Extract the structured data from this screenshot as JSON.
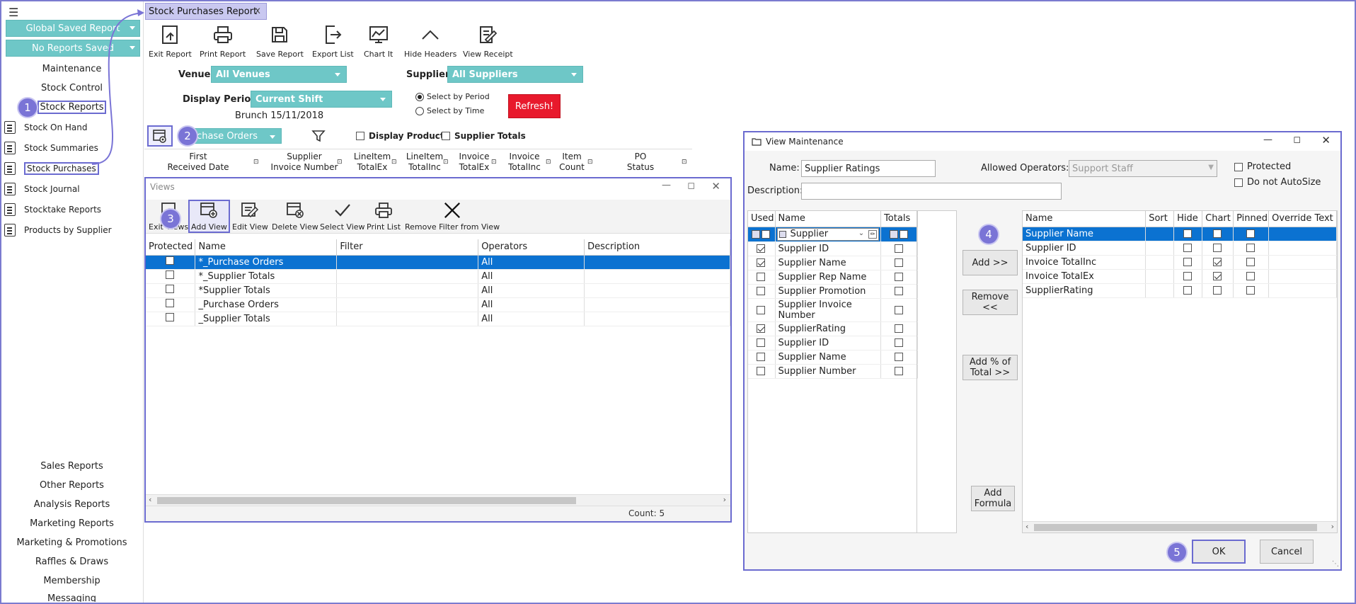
{
  "sidebar": {
    "global_saved": "Global Saved Report",
    "no_reports": "No Reports Saved",
    "links_top": [
      "Maintenance",
      "Stock Control",
      "Stock Reports"
    ],
    "sub_items": [
      "Stock On Hand",
      "Stock Summaries",
      "Stock Purchases",
      "Stock Journal",
      "Stocktake Reports",
      "Products by Supplier"
    ],
    "links_bottom": [
      "Sales Reports",
      "Other Reports",
      "Analysis Reports",
      "Marketing Reports",
      "Marketing & Promotions",
      "Raffles & Draws",
      "Membership",
      "Messaging"
    ]
  },
  "tab": {
    "title": "Stock Purchases Report",
    "close": "x"
  },
  "toolbar": [
    "Exit Report",
    "Print Report",
    "Save Report",
    "Export List",
    "Chart It",
    "Hide Headers",
    "View Receipt"
  ],
  "filters": {
    "venue_label": "Venue:",
    "venue_value": "All Venues",
    "supplier_label": "Supplier:",
    "supplier_value": "All Suppliers",
    "period_label": "Display Period:",
    "period_value": "Current Shift",
    "brunch": "Brunch 15/11/2018",
    "select_period": "Select by Period",
    "select_time": "Select  by Time",
    "refresh": "Refresh!",
    "view_dd": "rchase Orders",
    "display_products": "Display Products",
    "supplier_totals": "Supplier Totals"
  },
  "report_columns": [
    [
      "First",
      "Received Date"
    ],
    [
      "Supplier",
      "Invoice Number"
    ],
    [
      "LineItem",
      "TotalEx"
    ],
    [
      "LineItem",
      "TotalInc"
    ],
    [
      "Invoice",
      "TotalEx"
    ],
    [
      "Invoice",
      "TotalInc"
    ],
    [
      "Item",
      "Count"
    ],
    [
      "PO",
      "Status"
    ]
  ],
  "callouts": [
    "1",
    "2",
    "3",
    "4",
    "5"
  ],
  "views_window": {
    "title": "Views",
    "toolbar": [
      "Exit Views",
      "Add View",
      "Edit View",
      "Delete View",
      "Select View",
      "Print List",
      "Remove Filter from View"
    ],
    "columns": [
      "Protected",
      "Name",
      "Filter",
      "Operators",
      "Description"
    ],
    "rows": [
      {
        "name": "*_Purchase Orders",
        "filter": "",
        "operators": "All",
        "description": ""
      },
      {
        "name": "*_Supplier Totals",
        "filter": "",
        "operators": "All",
        "description": ""
      },
      {
        "name": "*Supplier Totals",
        "filter": "",
        "operators": "All",
        "description": ""
      },
      {
        "name": "_Purchase Orders",
        "filter": "",
        "operators": "All",
        "description": ""
      },
      {
        "name": "_Supplier Totals",
        "filter": "",
        "operators": "All",
        "description": ""
      }
    ],
    "count": "Count: 5"
  },
  "view_maintenance": {
    "title": "View Maintenance",
    "name_label": "Name:",
    "name_value": "Supplier Ratings",
    "allowed_label": "Allowed Operators:",
    "allowed_value": "Support Staff",
    "protected": "Protected",
    "do_not_autosize": "Do not AutoSize",
    "description_label": "Description:",
    "left_columns": [
      "Used",
      "Name",
      "Totals"
    ],
    "left_filter": "Supplier",
    "left_rows": [
      {
        "name": "Supplier ID",
        "used": true
      },
      {
        "name": "Supplier Name",
        "used": true
      },
      {
        "name": "Supplier Rep Name",
        "used": false
      },
      {
        "name": "Supplier Promotion",
        "used": false
      },
      {
        "name": "Supplier Invoice Number",
        "used": false
      },
      {
        "name": "SupplierRating",
        "used": true
      },
      {
        "name": "Supplier ID",
        "used": false
      },
      {
        "name": "Supplier Name",
        "used": false
      },
      {
        "name": "Supplier Number",
        "used": false
      }
    ],
    "mid_buttons": [
      "Add >>",
      "Remove <<",
      "Add % of Total >>",
      "Add Formula"
    ],
    "right_columns": [
      "Name",
      "Sort",
      "Hide",
      "Chart",
      "Pinned",
      "Override Text"
    ],
    "right_rows": [
      {
        "name": "Supplier Name",
        "chart": false
      },
      {
        "name": "Supplier ID",
        "chart": false
      },
      {
        "name": "Invoice TotalInc",
        "chart": true
      },
      {
        "name": "Invoice TotalEx",
        "chart": true
      },
      {
        "name": "SupplierRating",
        "chart": false
      }
    ],
    "ok": "OK",
    "cancel": "Cancel"
  }
}
